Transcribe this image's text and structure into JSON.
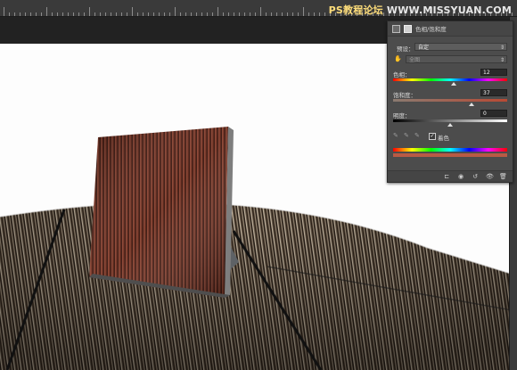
{
  "watermark": {
    "ps": "PS教程论坛",
    "site": "WWW.MISSYUAN.COM"
  },
  "panel": {
    "title": "色相/饱和度",
    "preset_label": "预设：",
    "preset_value": "自定",
    "channel_value": "全图",
    "hue_label": "色相：",
    "hue_value": "12",
    "saturation_label": "饱和度：",
    "saturation_value": "37",
    "lightness_label": "明度：",
    "lightness_value": "0",
    "colorize_label": "着色",
    "colorize_checked": true,
    "hue_slider_fraction": 0.53,
    "saturation_slider_fraction": 0.69,
    "lightness_slider_fraction": 0.5
  },
  "icons": {
    "panel_header": [
      "adjustment-layer-icon",
      "mask-icon"
    ],
    "hand_tool": "hand-target-icon",
    "eyedroppers": [
      "eyedropper-icon",
      "eyedropper-plus-icon",
      "eyedropper-minus-icon"
    ],
    "footer": [
      "clip-to-layer-icon",
      "view-previous-icon",
      "reset-icon",
      "visibility-icon",
      "delete-icon"
    ]
  },
  "colors": {
    "panel_bg": "#4c4c4c",
    "canvas_bg": "#fdfdfd",
    "app_bg": "#2a2a2a"
  }
}
